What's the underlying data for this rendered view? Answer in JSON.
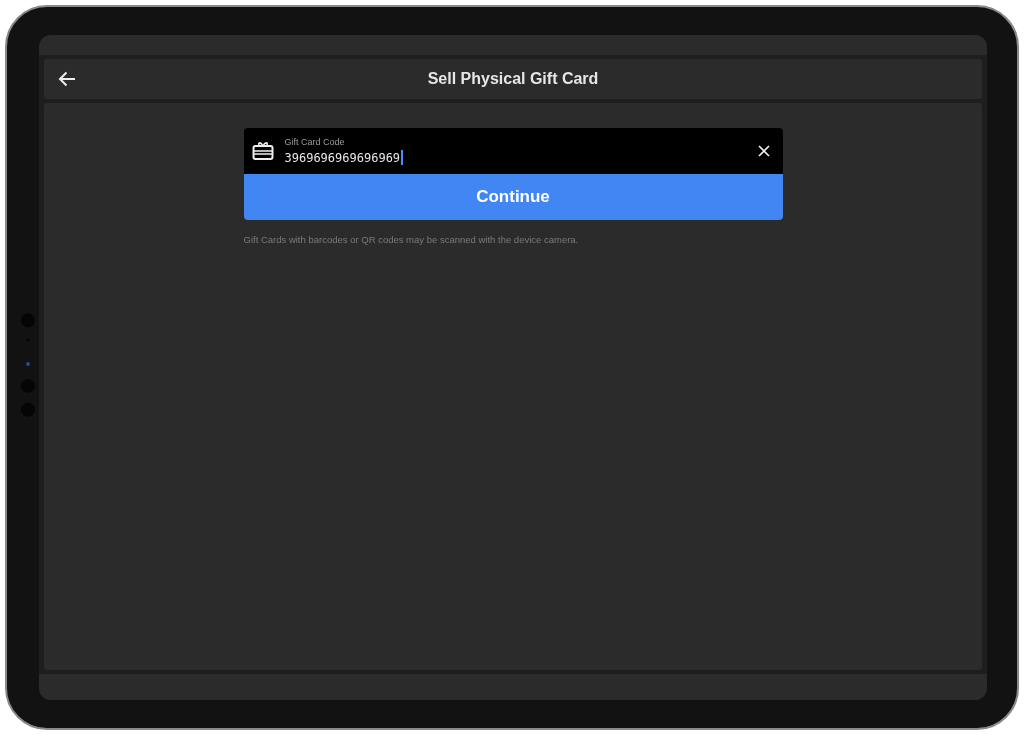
{
  "header": {
    "title": "Sell Physical Gift Card"
  },
  "code_field": {
    "label": "Gift Card Code",
    "value": "3969696969696969"
  },
  "continue_button": {
    "label": "Continue"
  },
  "hint": "Gift Cards with barcodes or QR codes may be scanned with the device camera."
}
